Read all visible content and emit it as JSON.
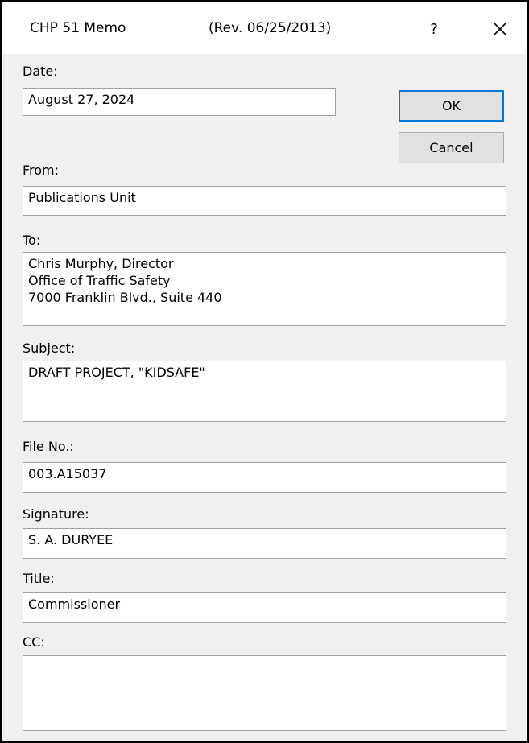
{
  "window": {
    "title": "CHP 51 Memo",
    "revision": "(Rev. 06/25/2013)",
    "help_label": "?"
  },
  "form": {
    "date_label": "Date:",
    "date_value": "August 27, 2024",
    "from_label": "From:",
    "from_value": "Publications Unit",
    "to_label": "To:",
    "to_value": "Chris Murphy, Director\nOffice of Traffic Safety\n7000 Franklin Blvd., Suite 440",
    "subject_label": "Subject:",
    "subject_value": "DRAFT PROJECT, \"KIDSAFE\"",
    "file_no_label": "File No.:",
    "file_no_value": "003.A15037",
    "signature_label": "Signature:",
    "signature_value": "S. A. DURYEE",
    "title_label": "Title:",
    "title_value": "Commissioner",
    "cc_label": "CC:",
    "cc_value": ""
  },
  "buttons": {
    "ok_label": "OK",
    "cancel_label": "Cancel"
  },
  "icons": {
    "help": "help-icon",
    "close": "close-icon"
  }
}
